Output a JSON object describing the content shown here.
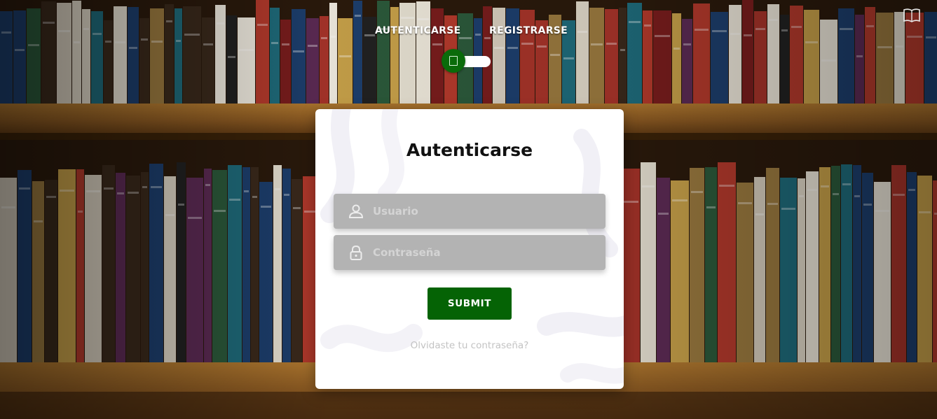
{
  "nav": {
    "tabs": [
      {
        "label": "AUTENTICARSE"
      },
      {
        "label": "REGISTRARSE"
      }
    ]
  },
  "icons": {
    "top_right": "book-icon",
    "toggle": "toggle-switch",
    "user_field": "user-icon",
    "password_field": "lock-icon"
  },
  "login": {
    "title": "Autenticarse",
    "username": {
      "value": "",
      "placeholder": "Usuario"
    },
    "password": {
      "value": "",
      "placeholder": "Contraseña"
    },
    "submit_label": "SUBMIT",
    "forgot_label": "Olvidaste tu contraseña?"
  },
  "colors": {
    "accent_green": "#056305",
    "field_bg": "#b3b3b3",
    "card_bg": "#ffffff"
  }
}
